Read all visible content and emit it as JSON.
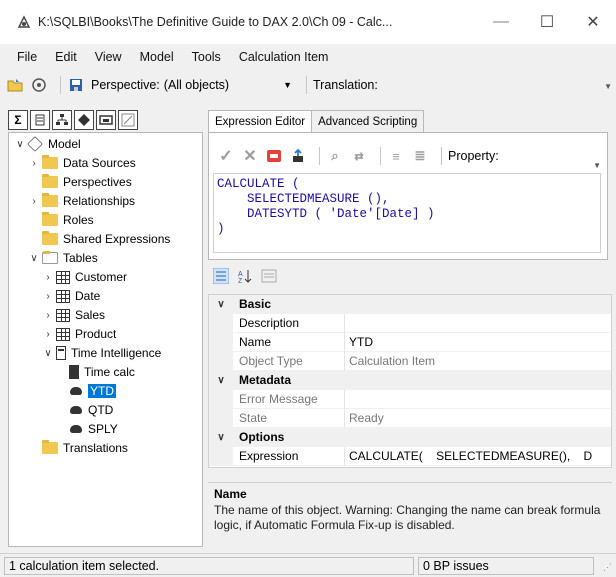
{
  "window": {
    "title": "K:\\SQLBI\\Books\\The Definitive Guide to DAX 2.0\\Ch 09 - Calc...",
    "min_glyph": "—",
    "max_glyph": "☐",
    "close_glyph": "✕"
  },
  "menu": [
    "File",
    "Edit",
    "View",
    "Model",
    "Tools",
    "Calculation Item"
  ],
  "toolbar": {
    "perspective_label": "Perspective:",
    "perspective_value": "(All objects)",
    "translation_label": "Translation:"
  },
  "tree": {
    "model": "Model",
    "data_sources": "Data Sources",
    "perspectives": "Perspectives",
    "relationships": "Relationships",
    "roles": "Roles",
    "shared_expressions": "Shared Expressions",
    "tables": "Tables",
    "customer": "Customer",
    "date": "Date",
    "sales": "Sales",
    "product": "Product",
    "time_intelligence": "Time Intelligence",
    "time_calc": "Time calc",
    "ytd": "YTD",
    "qtd": "QTD",
    "sply": "SPLY",
    "translations": "Translations"
  },
  "tabs": {
    "expression_editor": "Expression Editor",
    "advanced_scripting": "Advanced Scripting"
  },
  "editor": {
    "property_label": "Property:",
    "code_line1": "CALCULATE (",
    "code_line2": "    SELECTEDMEASURE (),",
    "code_line3": "    DATESYTD ( 'Date'[Date] )",
    "code_line4": ")"
  },
  "properties": {
    "basic": "Basic",
    "description": "Description",
    "name_label": "Name",
    "name_value": "YTD",
    "object_type_label": "Object Type",
    "object_type_value": "Calculation Item",
    "metadata": "Metadata",
    "error_message": "Error Message",
    "state_label": "State",
    "state_value": "Ready",
    "options": "Options",
    "expression_label": "Expression",
    "expression_value": "CALCULATE(    SELECTEDMEASURE(),    D"
  },
  "description_panel": {
    "title": "Name",
    "body": "The name of this object. Warning: Changing the name can break formula logic, if Automatic Formula Fix-up is disabled."
  },
  "status": {
    "left": "1 calculation item selected.",
    "mid": "0 BP issues"
  }
}
